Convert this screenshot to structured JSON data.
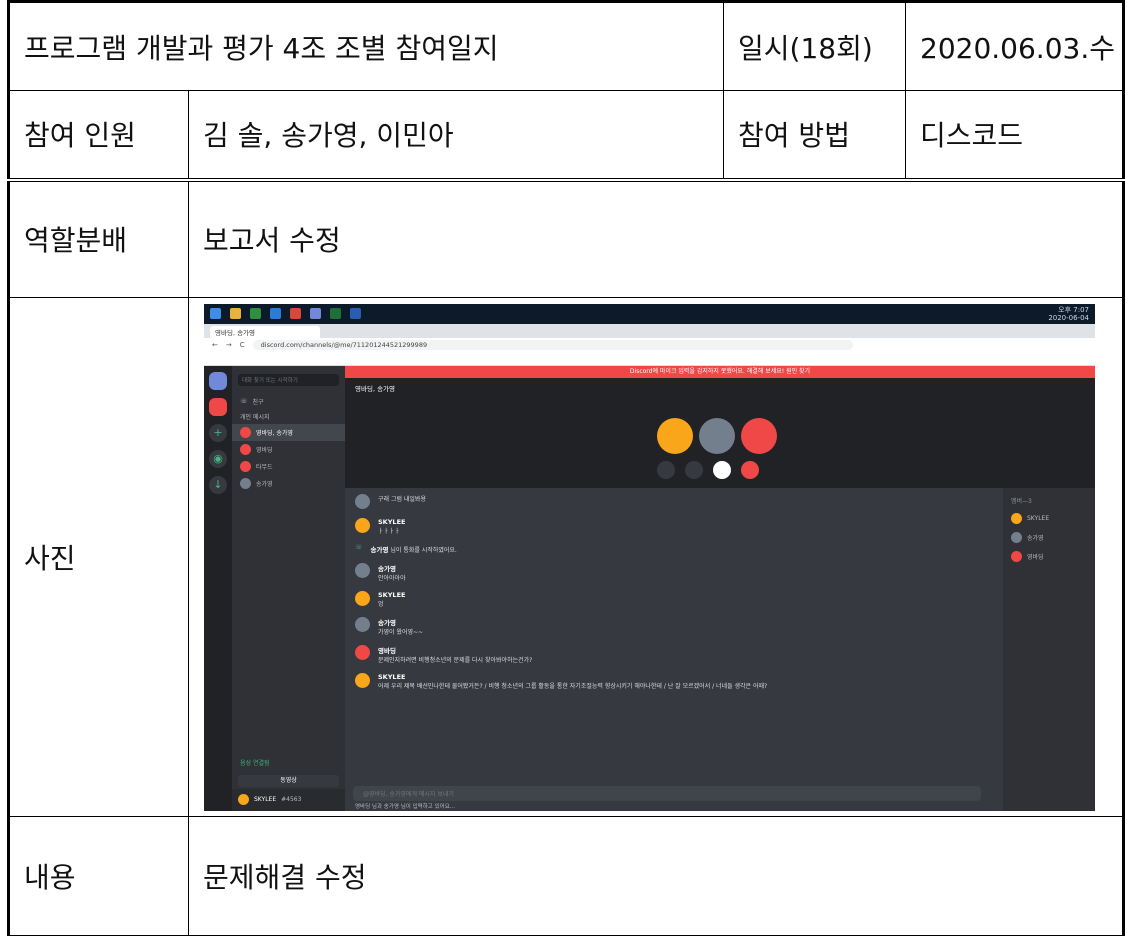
{
  "header": {
    "title": "프로그램 개발과 평가 4조 조별 참여일지",
    "date_label": "일시(18회)",
    "date_value": "2020.06.03.수"
  },
  "participants": {
    "label": "참여 인원",
    "value": "김 솔, 송가영, 이민아",
    "method_label": "참여 방법",
    "method_value": "디스코드"
  },
  "roles": {
    "label": "역할분배",
    "value": "보고서 수정"
  },
  "photo": {
    "label": "사진",
    "screenshot": {
      "tab_title": "영바딩, 송가영",
      "url": "discord.com/channels/@me/711201244521299989",
      "time": "오후 7:07",
      "date": "2020-06-04",
      "banner": "Discord에 마이크 입력을 감지하지 못했어요. 해결해 보세요!",
      "banner_link": "원인 찾기",
      "search_placeholder": "대화 찾기 또는 시작하기",
      "friends": "친구",
      "dm_header": "개인 메시지",
      "dm_items": [
        "영바딩, 송가영",
        "영바딩",
        "타무드",
        "송가영"
      ],
      "dm_sub": "멤버 3명",
      "call_name": "영바딩, 송가영",
      "voice_status": "음성 연결됨",
      "camera_button": "동영상",
      "username": "SKYLEE",
      "user_tag": "#4563",
      "messages": [
        {
          "author": "",
          "text": "구래 그럼 내일봐용",
          "color": "gry"
        },
        {
          "author": "SKYLEE",
          "text": "ㅏㅏㅏㅏ",
          "color": "org"
        },
        {
          "author": "송가영",
          "text": "님이 통화를 시작하였어요.",
          "color": "call"
        },
        {
          "author": "송가영",
          "text": "안아아아아",
          "color": "gry"
        },
        {
          "author": "SKYLEE",
          "text": "엉",
          "color": "org"
        },
        {
          "author": "송가영",
          "text": "가영이 왔어영~~",
          "color": "gry"
        },
        {
          "author": "영바딩",
          "text": "문제인지하려면 비행청소년의 문제를 다시 찾아봐야하는건가?",
          "color": "red"
        },
        {
          "author": "SKYLEE",
          "text": "어제 우리 제목 배선민나한테 물어봤거든? / 비행 청소년의 그룹 활동을 통한 자기조절능력 향상시키기 해야나한테 / 난 잘 모르겠어서 / 너네들 생각은 어때?",
          "color": "org"
        }
      ],
      "composer_placeholder": "@영바딩, 송가영에게 메시지 보내기",
      "typing": "영바딩 님과 송가영 님이 입력하고 있어요...",
      "members_header": "멤버—3",
      "members": [
        "SKYLEE",
        "송가영",
        "영바딩"
      ]
    }
  },
  "content": {
    "label": "내용",
    "value": "문제해결 수정"
  },
  "colors": {
    "discord_bg": "#36393f",
    "discord_sidebar": "#2f3136",
    "accent_red": "#f04747",
    "accent_orange": "#faa61a",
    "blurple": "#7289da"
  }
}
